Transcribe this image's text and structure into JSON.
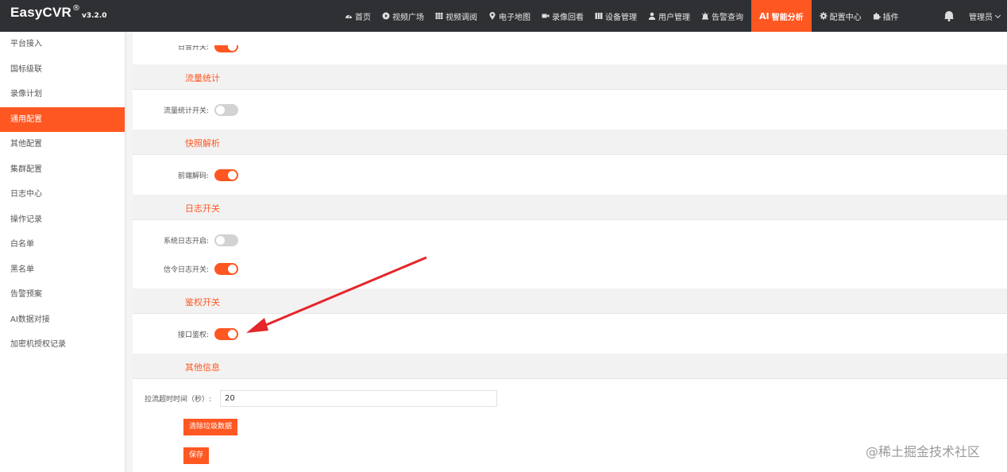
{
  "header": {
    "brand": "EasyCVR",
    "reg_mark": "®",
    "version": "v3.2.0",
    "nav": [
      {
        "label": "首页",
        "icon": "dashboard-icon"
      },
      {
        "label": "视频广场",
        "icon": "play-circle-icon"
      },
      {
        "label": "视频调阅",
        "icon": "grid-icon"
      },
      {
        "label": "电子地图",
        "icon": "map-pin-icon"
      },
      {
        "label": "录像回看",
        "icon": "video-camera-icon"
      },
      {
        "label": "设备管理",
        "icon": "columns-icon"
      },
      {
        "label": "用户管理",
        "icon": "user-icon"
      },
      {
        "label": "告警查询",
        "icon": "alarm-icon"
      },
      {
        "label": "智能分析",
        "prefix": "AI",
        "active": true
      },
      {
        "label": "配置中心",
        "icon": "gear-icon"
      },
      {
        "label": "插件",
        "icon": "puzzle-icon"
      }
    ],
    "user": "管理员"
  },
  "sidebar": {
    "items": [
      {
        "label": "平台接入"
      },
      {
        "label": "国标级联"
      },
      {
        "label": "录像计划"
      },
      {
        "label": "通用配置",
        "active": true
      },
      {
        "label": "其他配置"
      },
      {
        "label": "集群配置"
      },
      {
        "label": "日志中心"
      },
      {
        "label": "操作记录"
      },
      {
        "label": "白名单"
      },
      {
        "label": "黑名单"
      },
      {
        "label": "告警预案"
      },
      {
        "label": "AI数据对接"
      },
      {
        "label": "加密机授权记录"
      }
    ]
  },
  "main": {
    "top_partial_label": "日音开关:",
    "sections": {
      "traffic": {
        "title": "流量统计",
        "rows": [
          {
            "label": "流量统计开关:",
            "on": false
          }
        ]
      },
      "snapshot": {
        "title": "快照解析",
        "rows": [
          {
            "label": "前端解码:",
            "on": true
          }
        ]
      },
      "log": {
        "title": "日志开关",
        "rows": [
          {
            "label": "系统日志开启:",
            "on": false
          },
          {
            "label": "信令日志开关:",
            "on": true
          }
        ]
      },
      "auth": {
        "title": "鉴权开关",
        "rows": [
          {
            "label": "接口鉴权:",
            "on": true
          }
        ]
      },
      "other": {
        "title": "其他信息"
      }
    },
    "timeout_label": "拉流超时时间（秒）:",
    "timeout_value": "20",
    "clear_button": "清除垃圾数据",
    "save_button": "保存"
  },
  "watermark": "@稀土掘金技术社区",
  "colors": {
    "accent": "#ff5722",
    "topbar": "#2f3033",
    "annotation_arrow": "#e5262b"
  }
}
